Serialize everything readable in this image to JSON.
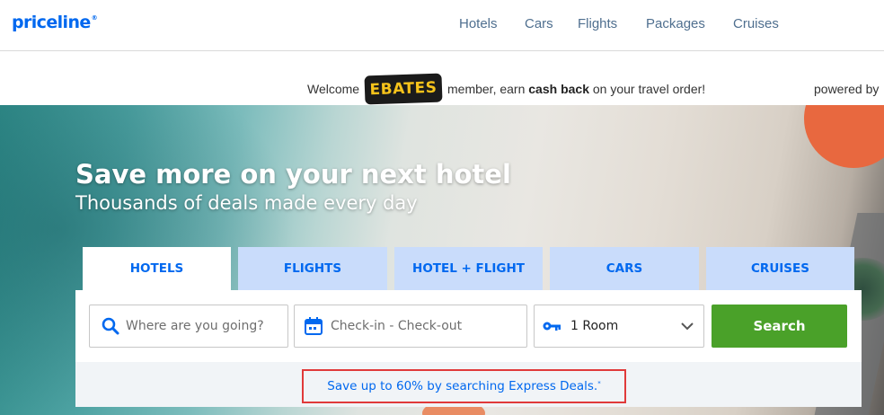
{
  "brand": {
    "logo": "priceline",
    "trademark": "®"
  },
  "nav": {
    "links": [
      "Hotels",
      "Cars",
      "Flights",
      "Packages",
      "Cruises"
    ]
  },
  "ebates": {
    "welcome": "Welcome",
    "logo_text": "EBATES",
    "member_text": "member, earn",
    "cash_back": "cash back",
    "suffix": "on your travel order!",
    "powered_by": "powered by"
  },
  "hero": {
    "title": "Save more on your next hotel",
    "subtitle": "Thousands of deals made every day"
  },
  "tabs": [
    {
      "label": "HOTELS",
      "active": true
    },
    {
      "label": "FLIGHTS",
      "active": false
    },
    {
      "label": "HOTEL + FLIGHT",
      "active": false
    },
    {
      "label": "CARS",
      "active": false
    },
    {
      "label": "CRUISES",
      "active": false
    }
  ],
  "search": {
    "destination_placeholder": "Where are you going?",
    "dates_placeholder": "Check-in - Check-out",
    "rooms_value": "1 Room",
    "button_label": "Search"
  },
  "promo": {
    "text": "Save up to 60% by searching Express Deals.",
    "marker": "*"
  },
  "colors": {
    "brand_blue": "#0068ef",
    "search_green": "#4aa129",
    "tab_inactive": "#c9dcfb",
    "highlight_red": "#e03a3a"
  },
  "icons": {
    "destination": "search-icon",
    "dates": "calendar-icon",
    "rooms": "key-icon",
    "rooms_toggle": "chevron-down-icon"
  }
}
